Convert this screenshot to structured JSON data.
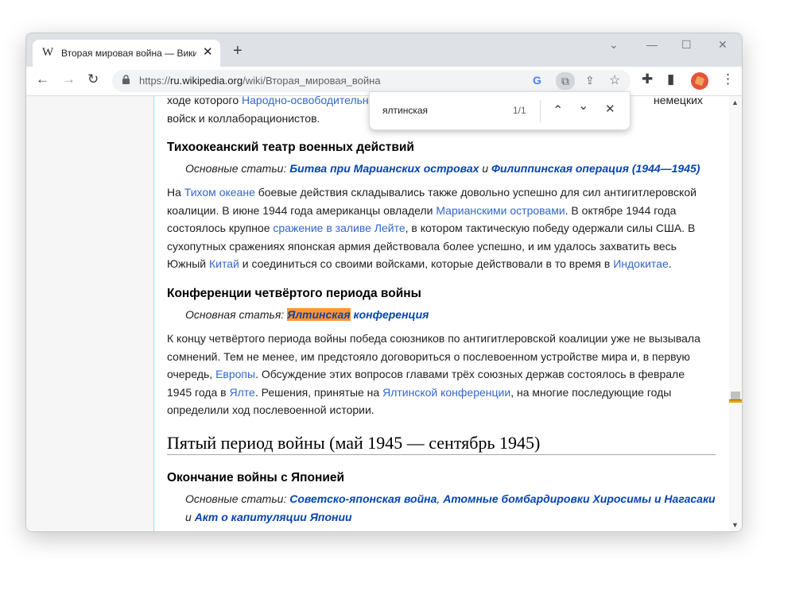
{
  "browser": {
    "tab_title": "Вторая мировая война — Википедия",
    "tab_favicon": "W",
    "url_scheme": "https://",
    "url_host": "ru.wikipedia.org",
    "url_path": "/wiki/Вторая_мировая_война",
    "icons": {
      "back": "←",
      "forward": "→",
      "reload": "↻",
      "close": "✕",
      "new_tab": "+",
      "minimize": "—",
      "maximize": "☐",
      "chevron": "⌄",
      "google": "G",
      "lens": "⧉",
      "share": "⇪",
      "star": "☆",
      "extensions": "✚",
      "sidepanel": "▮",
      "menu": "⋮",
      "lock": "🔒"
    }
  },
  "find": {
    "query": "ялтинская",
    "count": "1/1",
    "prev": "⌃",
    "next": "⌄",
    "close": "✕"
  },
  "article": {
    "top": {
      "prefix": "ходе которого ",
      "link": "Народно-освободительна",
      "tail": "немецких",
      "line2": "войск и коллаборационистов."
    },
    "pacific": {
      "heading": "Тихоокеанский театр военных действий",
      "hat_prefix": "Основные статьи: ",
      "hat_link1": "Битва при Марианских островах",
      "hat_and": " и ",
      "hat_link2": "Филиппинская операция (1944—1945)",
      "p": [
        "На ",
        "Тихом океане",
        " боевые действия складывались также довольно успешно для сил антигитлеровской коалиции. В июне 1944 года американцы овладели ",
        "Марианскими островами",
        ". В октябре 1944 года состоялось крупное ",
        "сражение в заливе Лейте",
        ", в котором тактическую победу одержали силы США. В сухопутных сражениях японская армия действовала более успешно, и им удалось захватить весь Южный ",
        "Китай",
        " и соединиться со своими войсками, которые действовали в то время в ",
        "Индокитае",
        "."
      ]
    },
    "conferences": {
      "heading": "Конференции четвёртого периода войны",
      "hat_prefix": "Основная статья: ",
      "hat_highlight": "Ялтинская",
      "hat_rest": " конференция",
      "p": [
        "К концу четвёртого периода войны победа союзников по антигитлеровской коалиции уже не вызывала сомнений. Тем не менее, им предстояло договориться о послевоенном устройстве мира и, в первую очередь, ",
        "Европы",
        ". Обсуждение этих вопросов главами трёх союзных держав состоялось в феврале 1945 года в ",
        "Ялте",
        ". Решения, принятые на ",
        "Ялтинской конференции",
        ", на многие последующие годы определили ход послевоенной истории."
      ]
    },
    "fifth": {
      "heading": "Пятый период войны (май 1945 — сентябрь 1945)"
    },
    "japan": {
      "heading": "Окончание войны с Японией",
      "hat_prefix": "Основные статьи: ",
      "hat_link1": "Советско-японская война",
      "hat_comma": ", ",
      "hat_link2": "Атомные бомбардировки Хиросимы и Нагасаки",
      "hat_and": " и ",
      "hat_link3": "Акт о капитуляции Японии"
    }
  },
  "colors": {
    "link": "#3366cc",
    "highlight": "#ff9632",
    "titlebar": "#dee1e6"
  }
}
